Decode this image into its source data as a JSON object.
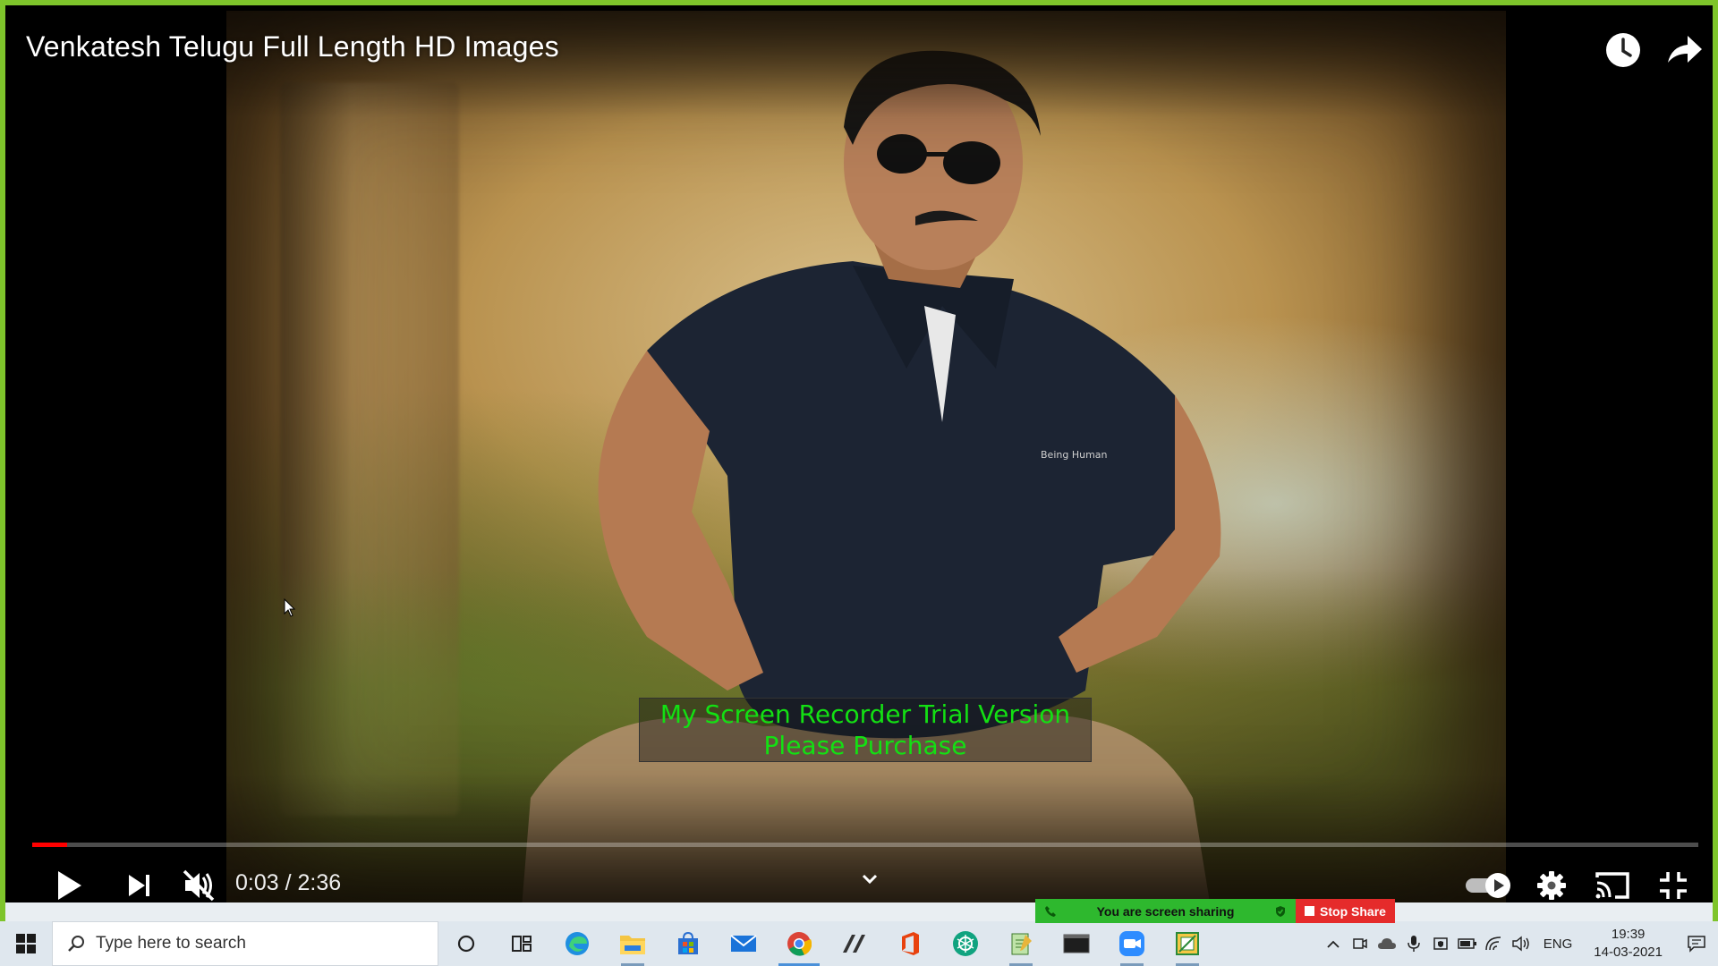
{
  "video": {
    "title": "Venkatesh Telugu Full Length HD Images",
    "current_time": "0:03",
    "separator": " / ",
    "duration": "2:36",
    "progress_fraction": 0.021,
    "autoplay": true
  },
  "watermark": {
    "line1": "My Screen Recorder Trial Version",
    "line2": "Please Purchase"
  },
  "poster": {
    "shirt_logo": "Being Human"
  },
  "screen_share": {
    "status": "You are screen sharing",
    "stop_label": "Stop Share"
  },
  "taskbar": {
    "search_placeholder": "Type here to search",
    "language": "ENG",
    "time": "19:39",
    "date": "14-03-2021",
    "apps": [
      "cortana-icon",
      "task-view-icon",
      "edge-icon",
      "file-explorer-icon",
      "microsoft-store-icon",
      "mail-icon",
      "chrome-icon",
      "wacom-icon",
      "office-icon",
      "chatgpt-icon",
      "notepad-icon",
      "terminal-icon",
      "zoom-icon",
      "snipping-tool-icon"
    ]
  },
  "colors": {
    "border_accent": "#7ec42b",
    "progress_red": "#ff0000",
    "watermark_green": "#13e013",
    "share_green": "#2eb82e",
    "stop_red": "#e52b2b"
  }
}
